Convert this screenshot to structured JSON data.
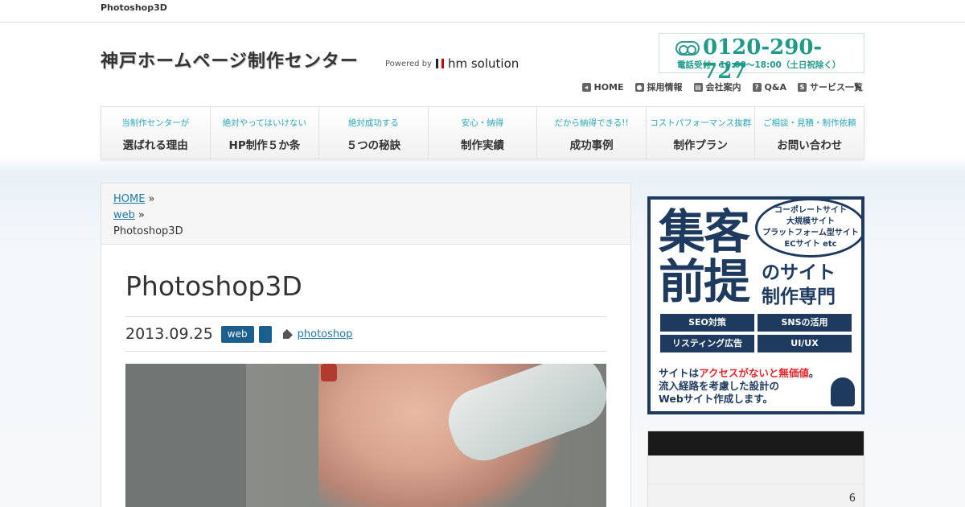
{
  "topbar": {
    "tagline": "Photoshop3D"
  },
  "header": {
    "site_title": "神戸ホームページ制作センター",
    "powered_by": "Powered by",
    "company": "hm solution",
    "phone": "0120-290-727",
    "hours": "電話受付　10:00〜18:00（土日祝除く）"
  },
  "util_nav": [
    {
      "label": "HOME",
      "icon": "home-icon",
      "glyph": "◂"
    },
    {
      "label": "採用情報",
      "icon": "person-icon",
      "glyph": "●"
    },
    {
      "label": "会社案内",
      "icon": "document-icon",
      "glyph": "▤"
    },
    {
      "label": "Q&A",
      "icon": "question-icon",
      "glyph": "?"
    },
    {
      "label": "サービス一覧",
      "icon": "service-icon",
      "glyph": "S"
    }
  ],
  "main_nav": [
    {
      "sub": "当制作センターが",
      "main": "選ばれる理由"
    },
    {
      "sub": "絶対やってはいけない",
      "main": "HP制作５か条"
    },
    {
      "sub": "絶対成功する",
      "main": "５つの秘訣"
    },
    {
      "sub": "安心・納得",
      "main": "制作実績"
    },
    {
      "sub": "だから納得できる!!",
      "main": "成功事例"
    },
    {
      "sub": "コストパフォーマンス抜群",
      "main": "制作プラン"
    },
    {
      "sub": "ご相談・見積・制作依頼",
      "main": "お問い合わせ"
    }
  ],
  "breadcrumb": {
    "home": "HOME",
    "sep": "»",
    "category": "web",
    "current": "Photoshop3D"
  },
  "post": {
    "title": "Photoshop3D",
    "date": "2013.09.25",
    "category": "web",
    "tag": "photoshop"
  },
  "ad": {
    "line1": "集客",
    "line2": "前提",
    "side1": "のサイト",
    "side2": "制作専門",
    "bubble": [
      "コーポレートサイト",
      "大規模サイト",
      "プラットフォーム型サイト",
      "ECサイト etc"
    ],
    "buttons": [
      "SEO対策",
      "SNSの活用",
      "リスティング広告",
      "UI/UX"
    ],
    "bottom_pre": "サイトは",
    "bottom_red": "アクセスがないと無価値",
    "bottom_post": "。",
    "bottom2": "流入経路を考慮した設計の",
    "bottom3": "Webサイト作成します。"
  },
  "widget": {
    "count": "6"
  },
  "colors": {
    "accent": "#1e77a8",
    "category_bg": "#1b5f8f",
    "phone": "#1f9a88",
    "ad_navy": "#1e3a5f"
  }
}
